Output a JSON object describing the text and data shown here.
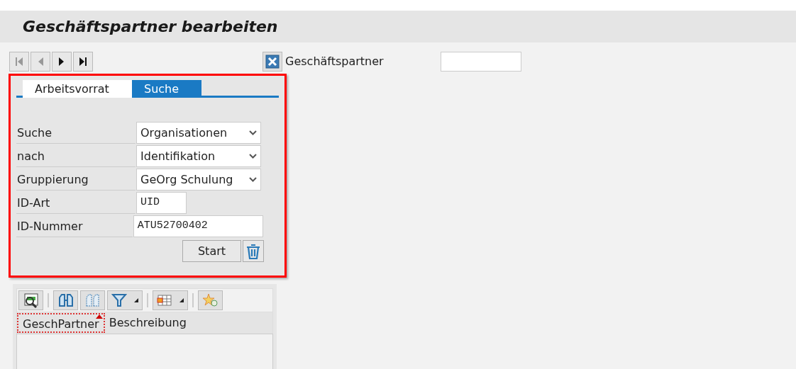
{
  "window": {
    "title": "Geschäftspartner bearbeiten"
  },
  "partner_field": {
    "label": "Geschäftspartner"
  },
  "tabs": [
    {
      "label": "Arbeitsvorrat",
      "selected": false
    },
    {
      "label": "Suche",
      "selected": true
    }
  ],
  "search_form": [
    {
      "label": "Suche",
      "kind": "select",
      "value": "Organisationen"
    },
    {
      "label": "nach",
      "kind": "select",
      "value": "Identifikation"
    },
    {
      "label": "Gruppierung",
      "kind": "select",
      "value": "GeOrg Schulung"
    },
    {
      "label": "ID-Art",
      "kind": "short",
      "value": "UID"
    },
    {
      "label": "ID-Nummer",
      "kind": "long",
      "value": "ATU52700402"
    }
  ],
  "start_button": "Start",
  "table": {
    "columns": [
      {
        "label": "GeschPartner",
        "sorted": true
      },
      {
        "label": "Beschreibung",
        "sorted": false
      }
    ]
  }
}
